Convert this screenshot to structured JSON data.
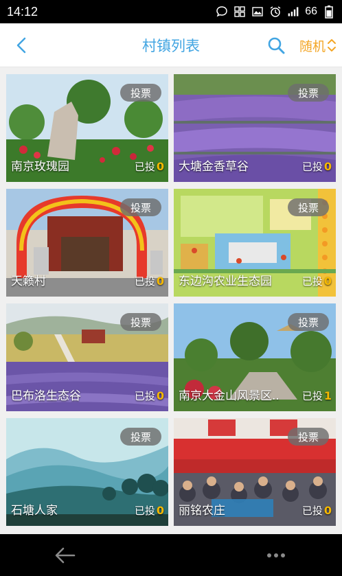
{
  "status_bar": {
    "time": "14:12",
    "battery": "66"
  },
  "header": {
    "title": "村镇列表",
    "random_label": "随机"
  },
  "colors": {
    "accent": "#42a5e2",
    "random": "#f3a626",
    "vote_count": "#f5b800"
  },
  "cards": [
    {
      "name": "南京玫瑰园",
      "vote_label": "投票",
      "voted_prefix": "已投",
      "voted_count": "0"
    },
    {
      "name": "大塘金香草谷",
      "vote_label": "投票",
      "voted_prefix": "已投",
      "voted_count": "0"
    },
    {
      "name": "天籁村",
      "vote_label": "投票",
      "voted_prefix": "已投",
      "voted_count": "0"
    },
    {
      "name": "东边沟农业生态园",
      "vote_label": "投票",
      "voted_prefix": "已投",
      "voted_count": "0"
    },
    {
      "name": "巴布洛生态谷",
      "vote_label": "投票",
      "voted_prefix": "已投",
      "voted_count": "0"
    },
    {
      "name": "南京大金山风景区..",
      "vote_label": "投票",
      "voted_prefix": "已投",
      "voted_count": "1"
    },
    {
      "name": "石塘人家",
      "vote_label": "投票",
      "voted_prefix": "已投",
      "voted_count": "0"
    },
    {
      "name": "丽铭农庄",
      "vote_label": "投票",
      "voted_prefix": "已投",
      "voted_count": "0"
    }
  ],
  "icons": {
    "back": "chevron-left-icon",
    "search": "search-icon",
    "random_toggle": "chevron-updown-icon",
    "nav_back": "arrow-left-icon",
    "nav_more": "more-dots-icon"
  }
}
